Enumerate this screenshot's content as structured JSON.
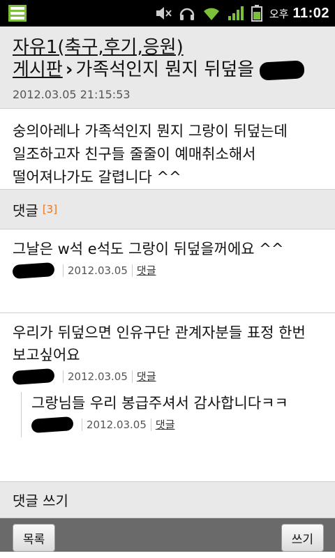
{
  "status": {
    "ampm": "오후",
    "time": "11:02"
  },
  "post": {
    "board": "자유1(축구,후기,응원)게시판",
    "separator": "›",
    "title": "가족석인지 뭔지 뒤덮을",
    "date": "2012.03.05 21:15:53",
    "body": "숭의아레나 가족석인지 뭔지 그랑이 뒤덮는데 일조하고자 친구들 줄줄이 예매취소해서 떨어져나가도 갈렵니다 ^^"
  },
  "comments_section": {
    "label": "댓글",
    "count": "[3]"
  },
  "comments": [
    {
      "text": "그날은 w석 e석도 그랑이 뒤덮을꺼에요 ^^",
      "date": "2012.03.05",
      "reply_label": "댓글"
    },
    {
      "text": "우리가 뒤덮으면 인유구단 관계자분들 표정 한번 보고싶어요",
      "date": "2012.03.05",
      "reply_label": "댓글"
    }
  ],
  "reply": {
    "text": "그랑님들 우리 봉급주셔서 감사합니다ㅋㅋ",
    "date": "2012.03.05",
    "reply_label": "댓글"
  },
  "write_comment_label": "댓글 쓰기",
  "bottom": {
    "list_button": "목록",
    "write_button": "쓰기"
  }
}
